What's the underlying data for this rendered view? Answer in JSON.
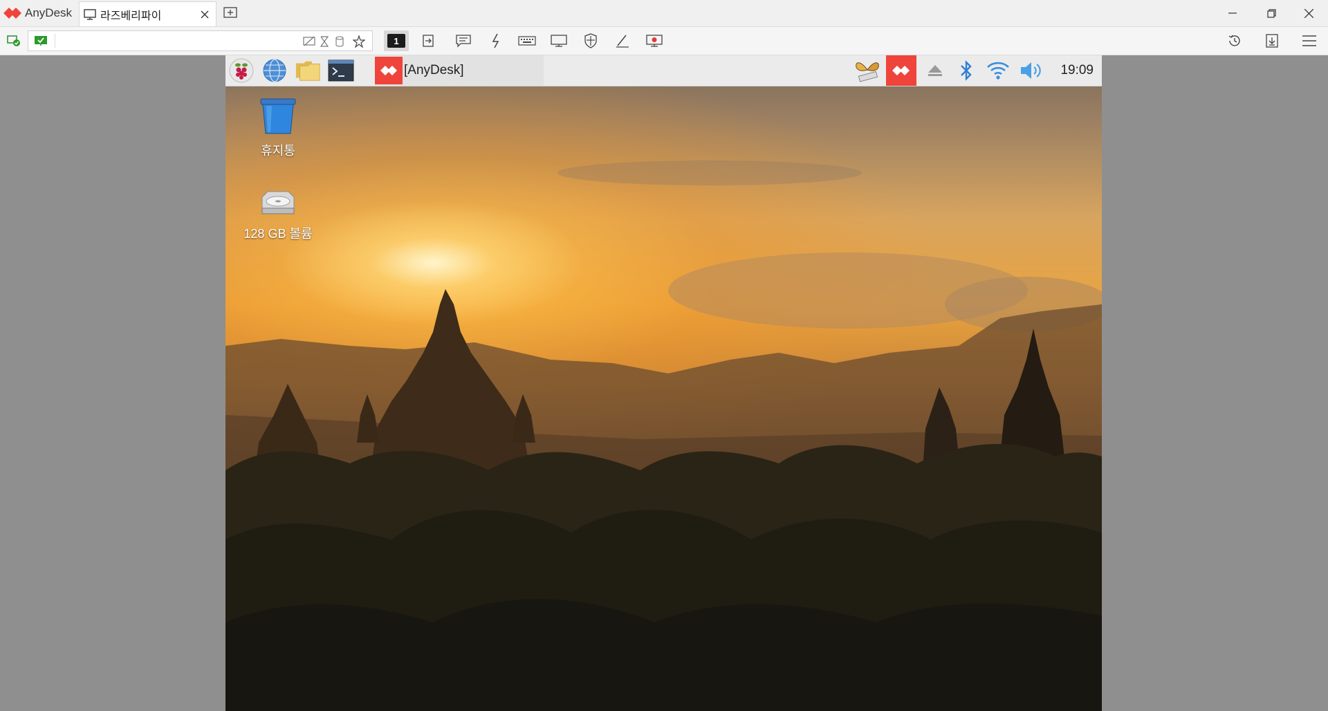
{
  "app": {
    "name": "AnyDesk",
    "brand_color": "#ef443b"
  },
  "tabs": [
    {
      "label": "라즈베리파이",
      "icon": "monitor-icon",
      "active": true
    }
  ],
  "window_controls": [
    "minimize-icon",
    "restore-icon",
    "close-icon"
  ],
  "toolbar": {
    "address_value": "",
    "address_icons": [
      "view-only-icon",
      "hourglass-icon",
      "database-icon",
      "star-icon"
    ],
    "monitor_number": "1",
    "buttons": [
      "switch-sides-icon",
      "chat-icon",
      "actions-lightning-icon",
      "keyboard-icon",
      "display-icon",
      "permissions-shield-icon",
      "whiteboard-pen-icon",
      "record-icon"
    ],
    "right_buttons": [
      "history-icon",
      "file-transfer-icon",
      "menu-icon"
    ]
  },
  "remote": {
    "panel": {
      "launchers": [
        "raspberry-menu-icon",
        "web-browser-icon",
        "file-manager-icon",
        "terminal-icon"
      ],
      "task_label": "[AnyDesk]",
      "tray": [
        "butterfly-app-icon",
        "anydesk-tray-icon",
        "eject-icon",
        "bluetooth-icon",
        "wifi-icon",
        "volume-icon"
      ],
      "clock": "19:09"
    },
    "desktop_icons": [
      {
        "label": "휴지통",
        "icon": "trash-bin-icon"
      },
      {
        "label": "128 GB 볼륨",
        "icon": "drive-icon"
      }
    ]
  }
}
